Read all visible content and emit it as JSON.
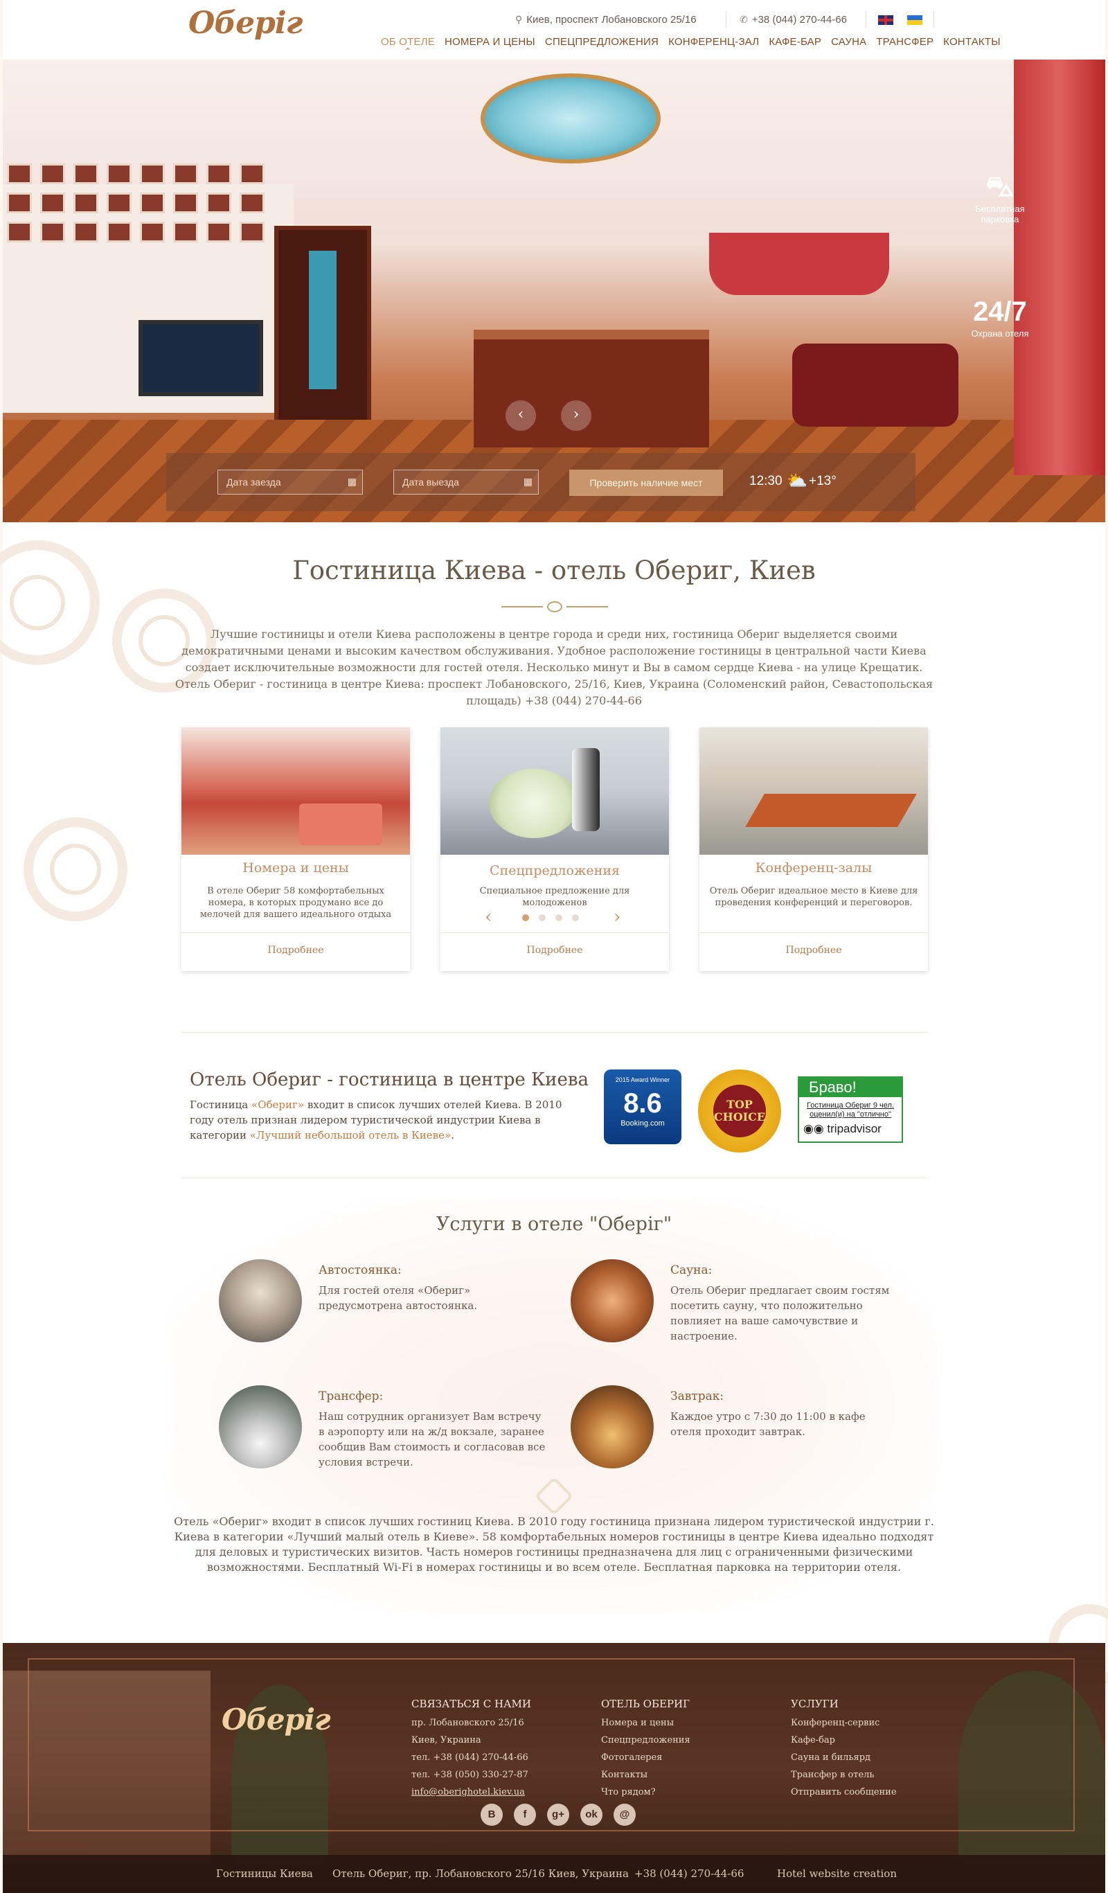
{
  "header": {
    "logo": "Оберіг",
    "address": "Киев, проспект Лобановского 25/16",
    "phone": "+38 (044) 270-44-66",
    "nav": [
      "ОБ ОТЕЛЕ",
      "НОМЕРА И ЦЕНЫ",
      "СПЕЦПРЕДЛОЖЕНИЯ",
      "КОНФЕРЕНЦ-ЗАЛ",
      "КАФЕ-БАР",
      "САУНА",
      "ТРАНСФЕР",
      "КОНТАКТЫ"
    ],
    "active_nav": "ОБ ОТЕЛЕ"
  },
  "hero": {
    "features": [
      {
        "icon": "car-parking-icon",
        "label": "Бесплатная парковка"
      },
      {
        "icon": "cctv-24-7-icon",
        "label": "Охрана отеля",
        "badge": "24/7"
      }
    ],
    "booking": {
      "checkin_placeholder": "Дата заезда",
      "checkout_placeholder": "Дата выезда",
      "check_button": "Проверить наличие мест",
      "time": "12:30",
      "temperature": "+13°"
    }
  },
  "intro": {
    "title": "Гостиница Киева - отель Обериг, Киев",
    "text": "Лучшие гостиницы и отели Киева расположены в центре города и среди них, гостиница Обериг выделяется своими демократичными ценами и высоким качеством обслуживания. Удобное расположение гостиницы в центральной части Киева создает исключительные возможности для гостей отеля. Несколько минут и Вы в самом сердце Киева - на улице Крещатик. Отель Обериг - гостиница в центре Киева: проспект Лобановского, 25/16, Киев, Украина (Соломенский район, Севастопольская площадь) +38 (044) 270-44-66"
  },
  "cards": [
    {
      "title": "Номера и цены",
      "text": "В отеле Обериг 58 комфортабельных номера, в которых продумано все до мелочей для вашего идеального отдыха",
      "more": "Подробнее"
    },
    {
      "title": "Спецпредложения",
      "text": "Специальное предложение для молодоженов",
      "more": "Подробнее"
    },
    {
      "title": "Конференц-залы",
      "text": "Отель Обериг идеальное место в Киеве для проведения конференций и переговоров.",
      "more": "Подробнее"
    }
  ],
  "awards": {
    "title": "Отель Обериг - гостиница в центре Киева",
    "text_before": "Гостиница ",
    "text_hl1": "«Обериг»",
    "text_mid": " входит в список лучших отелей Киева. В 2010 году отель признан лидером туристической индустрии Киева в категории ",
    "text_hl2": "«Лучший небольшой отель в Киеве»",
    "text_end": ".",
    "booking_top": "2015 Award Winner",
    "booking_score": "8.6",
    "booking_brand": "Booking.com",
    "top_choice": "TOP CHOICE",
    "ta_head": "Браво!",
    "ta_body": "Гостиница Обериг 9 чел. оценил(и) на \"отлично\"",
    "ta_logo": "tripadvisor"
  },
  "services": {
    "title": "Услуги в отеле \"Оберіг\"",
    "items": [
      {
        "name": "Автостоянка:",
        "desc": "Для гостей отеля «Обериг» предусмотрена автостоянка."
      },
      {
        "name": "Сауна:",
        "desc": "Отель Обериг предлагает своим гостям посетить сауну, что положительно повлияет на ваше самочувствие и настроение."
      },
      {
        "name": "Трансфер:",
        "desc": "Наш сотрудник организует Вам встречу в аэропорту или на ж/д вокзале, заранее сообщив Вам стоимость и согласовав все условия встречи."
      },
      {
        "name": "Завтрак:",
        "desc": "Каждое утро с 7:30 до 11:00 в кафе отеля проходит завтрак."
      }
    ],
    "text": "Отель «Обериг» входит в список лучших гостиниц Киева. В 2010 году гостиница признана лидером туристической индустрии г. Киева в категории «Лучший малый отель в Киеве». 58 комфортабельных номеров гостиницы в центре Киева идеально подходят для деловых и туристических визитов. Часть номеров гостиницы предназначена для лиц с ограниченными физическими возможностями. Бесплатный Wi-Fi в номерах гостиницы и во всем отеле. Бесплатная парковка на территории отеля."
  },
  "footer": {
    "logo": "Оберіг",
    "contact": {
      "heading": "СВЯЗАТЬСЯ С НАМИ",
      "lines": [
        "пр. Лобановского 25/16",
        "Киев, Украина",
        "тел. +38 (044) 270-44-66",
        "тел. +38 (050) 330-27-87",
        "info@oberighotel.kiev.ua"
      ]
    },
    "hotel": {
      "heading": "ОТЕЛЬ ОБЕРИГ",
      "links": [
        "Номера и цены",
        "Спецпредложения",
        "Фотогалерея",
        "Контакты",
        "Что рядом?"
      ]
    },
    "services": {
      "heading": "УСЛУГИ",
      "links": [
        "Конференц-сервис",
        "Кафе-бар",
        "Сауна и бильярд",
        "Трансфер в отель",
        "Отправить сообщение"
      ]
    },
    "socials": [
      {
        "icon": "vk-icon",
        "glyph": "В"
      },
      {
        "icon": "facebook-icon",
        "glyph": "f"
      },
      {
        "icon": "google-plus-icon",
        "glyph": "g+"
      },
      {
        "icon": "odnoklassniki-icon",
        "glyph": "ok"
      },
      {
        "icon": "email-icon",
        "glyph": "@"
      }
    ],
    "bottom": [
      "Гостиницы Киева",
      "Отель Обериг, пр. Лобановского 25/16 Киев, Украина",
      "+38 (044) 270-44-66",
      "Hotel website creation"
    ]
  }
}
